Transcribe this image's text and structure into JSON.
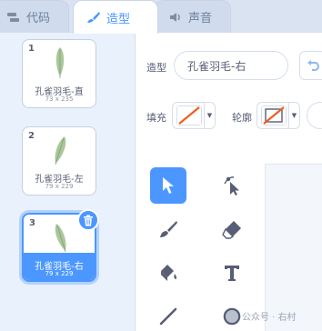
{
  "tabs": [
    {
      "label": "代码",
      "icon": "code-icon",
      "active": false
    },
    {
      "label": "造型",
      "icon": "brush-icon",
      "active": true
    },
    {
      "label": "声音",
      "icon": "speaker-icon",
      "active": false
    }
  ],
  "costumes": [
    {
      "number": "1",
      "name": "孔雀羽毛-直",
      "dims": "73 x 235",
      "selected": false
    },
    {
      "number": "2",
      "name": "孔雀羽毛-左",
      "dims": "79 x 229",
      "selected": false
    },
    {
      "number": "3",
      "name": "孔雀羽毛-右",
      "dims": "79 x 229",
      "selected": true
    }
  ],
  "editor": {
    "costume_label": "造型",
    "costume_name": "孔雀羽毛-右",
    "fill_label": "填充",
    "outline_label": "轮廓"
  },
  "tools": [
    "select-icon",
    "reshape-icon",
    "brush-icon",
    "eraser-icon",
    "fill-icon",
    "text-icon",
    "line-icon",
    "circle-icon"
  ],
  "watermark": "公众号 · 右村",
  "colors": {
    "accent": "#4c97ff",
    "text": "#575e75",
    "no_color_slash": "#f25c1b",
    "feather": "#a9c79b"
  }
}
